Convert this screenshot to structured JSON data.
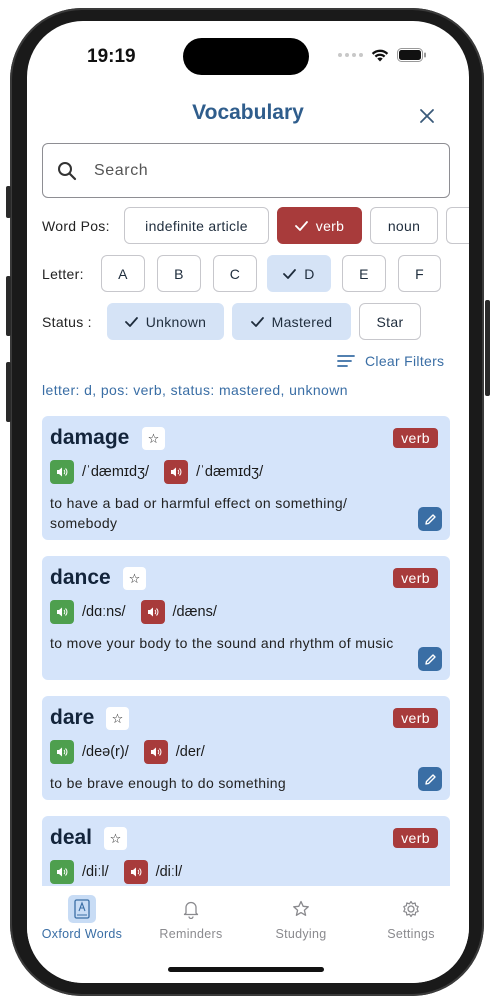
{
  "status_bar": {
    "time": "19:19"
  },
  "header": {
    "title": "Vocabulary"
  },
  "search": {
    "placeholder": "Search"
  },
  "filters": {
    "pos_label": "Word Pos:",
    "pos_options": [
      {
        "label": "indefinite article",
        "selected": false
      },
      {
        "label": "verb",
        "selected": true
      },
      {
        "label": "noun",
        "selected": false
      }
    ],
    "letter_label": "Letter:",
    "letter_options": [
      {
        "label": "A",
        "selected": false
      },
      {
        "label": "B",
        "selected": false
      },
      {
        "label": "C",
        "selected": false
      },
      {
        "label": "D",
        "selected": true
      },
      {
        "label": "E",
        "selected": false
      },
      {
        "label": "F",
        "selected": false
      }
    ],
    "status_label": "Status :",
    "status_options": [
      {
        "label": "Unknown",
        "selected": true
      },
      {
        "label": "Mastered",
        "selected": true
      },
      {
        "label": "Star",
        "selected": false
      }
    ],
    "clear_label": "Clear Filters",
    "summary": "letter: d, pos: verb, status: mastered, unknown"
  },
  "words": [
    {
      "word": "damage",
      "pos": "verb",
      "uk": "/ˈdæmɪdʒ/",
      "us": "/ˈdæmɪdʒ/",
      "definition": "to have a bad or harmful effect on something/ somebody"
    },
    {
      "word": "dance",
      "pos": "verb",
      "uk": "/dɑːns/",
      "us": "/dæns/",
      "definition": "to move your body to the sound and rhythm of music"
    },
    {
      "word": "dare",
      "pos": "verb",
      "uk": "/deə(r)/",
      "us": "/der/",
      "definition": "to be brave enough to do something"
    },
    {
      "word": "deal",
      "pos": "verb",
      "uk": "/diːl/",
      "us": "/diːl/",
      "definition": ""
    }
  ],
  "tabs": [
    {
      "label": "Oxford Words",
      "icon": "book-icon",
      "active": true
    },
    {
      "label": "Reminders",
      "icon": "bell-icon",
      "active": false
    },
    {
      "label": "Studying",
      "icon": "star-icon",
      "active": false
    },
    {
      "label": "Settings",
      "icon": "gear-icon",
      "active": false
    }
  ],
  "colors": {
    "accent": "#3a6ea5",
    "selected_pos": "#a83b3b",
    "selected_chip": "#d5e3f6",
    "card_bg": "#d5e4fa",
    "uk_speaker": "#4e9f4e"
  }
}
